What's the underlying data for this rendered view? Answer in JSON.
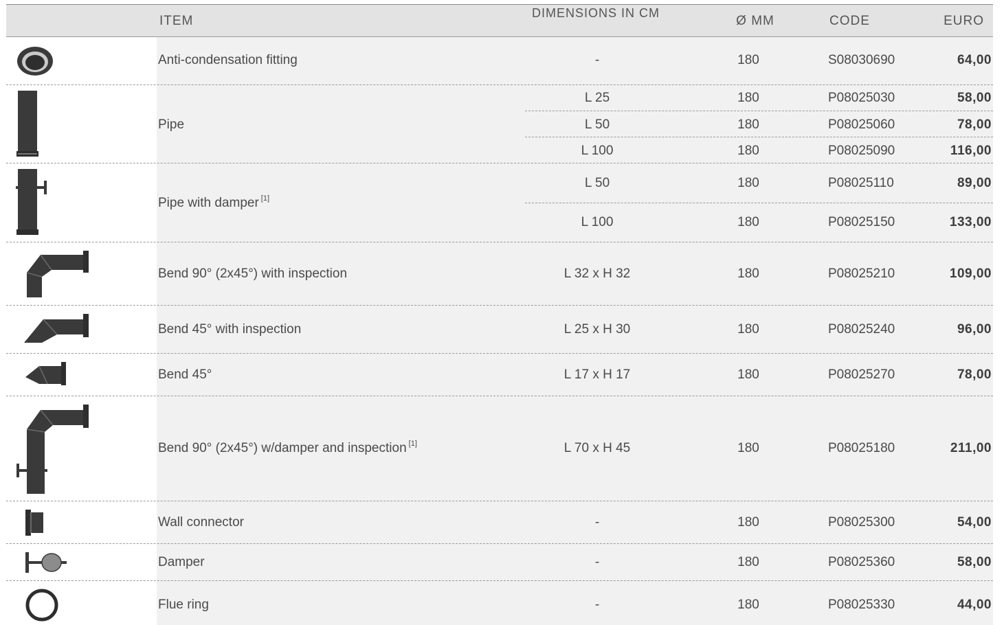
{
  "header": {
    "item": "ITEM",
    "dimensions": "DIMENSIONS IN CM",
    "diameter": "Ø MM",
    "code": "CODE",
    "euro": "EURO"
  },
  "rows": [
    {
      "name": "Anti-condensation fitting",
      "icon": "anti-condensation-fitting-icon",
      "variants": [
        {
          "dim": "-",
          "dia": "180",
          "code": "S08030690",
          "euro": "64,00"
        }
      ]
    },
    {
      "name": "Pipe",
      "icon": "pipe-icon",
      "variants": [
        {
          "dim": "L 25",
          "dia": "180",
          "code": "P08025030",
          "euro": "58,00"
        },
        {
          "dim": "L 50",
          "dia": "180",
          "code": "P08025060",
          "euro": "78,00"
        },
        {
          "dim": "L 100",
          "dia": "180",
          "code": "P08025090",
          "euro": "116,00"
        }
      ]
    },
    {
      "name": "Pipe with damper",
      "note": "[1]",
      "icon": "pipe-with-damper-icon",
      "variants": [
        {
          "dim": "L 50",
          "dia": "180",
          "code": "P08025110",
          "euro": "89,00"
        },
        {
          "dim": "L 100",
          "dia": "180",
          "code": "P08025150",
          "euro": "133,00"
        }
      ]
    },
    {
      "name": "Bend 90° (2x45°) with inspection",
      "icon": "bend-90-icon",
      "variants": [
        {
          "dim": "L 32 x H 32",
          "dia": "180",
          "code": "P08025210",
          "euro": "109,00"
        }
      ]
    },
    {
      "name": "Bend 45° with inspection",
      "icon": "bend-45-inspection-icon",
      "variants": [
        {
          "dim": "L 25 x H 30",
          "dia": "180",
          "code": "P08025240",
          "euro": "96,00"
        }
      ]
    },
    {
      "name": "Bend 45°",
      "icon": "bend-45-icon",
      "variants": [
        {
          "dim": "L 17 x H 17",
          "dia": "180",
          "code": "P08025270",
          "euro": "78,00"
        }
      ]
    },
    {
      "name": "Bend 90° (2x45°) w/damper and inspection",
      "note": "[1]",
      "icon": "bend-90-damper-icon",
      "variants": [
        {
          "dim": "L 70 x H 45",
          "dia": "180",
          "code": "P08025180",
          "euro": "211,00"
        }
      ]
    },
    {
      "name": "Wall connector",
      "icon": "wall-connector-icon",
      "variants": [
        {
          "dim": "-",
          "dia": "180",
          "code": "P08025300",
          "euro": "54,00"
        }
      ]
    },
    {
      "name": "Damper",
      "icon": "damper-icon",
      "variants": [
        {
          "dim": "-",
          "dia": "180",
          "code": "P08025360",
          "euro": "58,00"
        }
      ]
    },
    {
      "name": "Flue ring",
      "icon": "flue-ring-icon",
      "variants": [
        {
          "dim": "-",
          "dia": "180",
          "code": "P08025330",
          "euro": "44,00"
        }
      ]
    }
  ]
}
